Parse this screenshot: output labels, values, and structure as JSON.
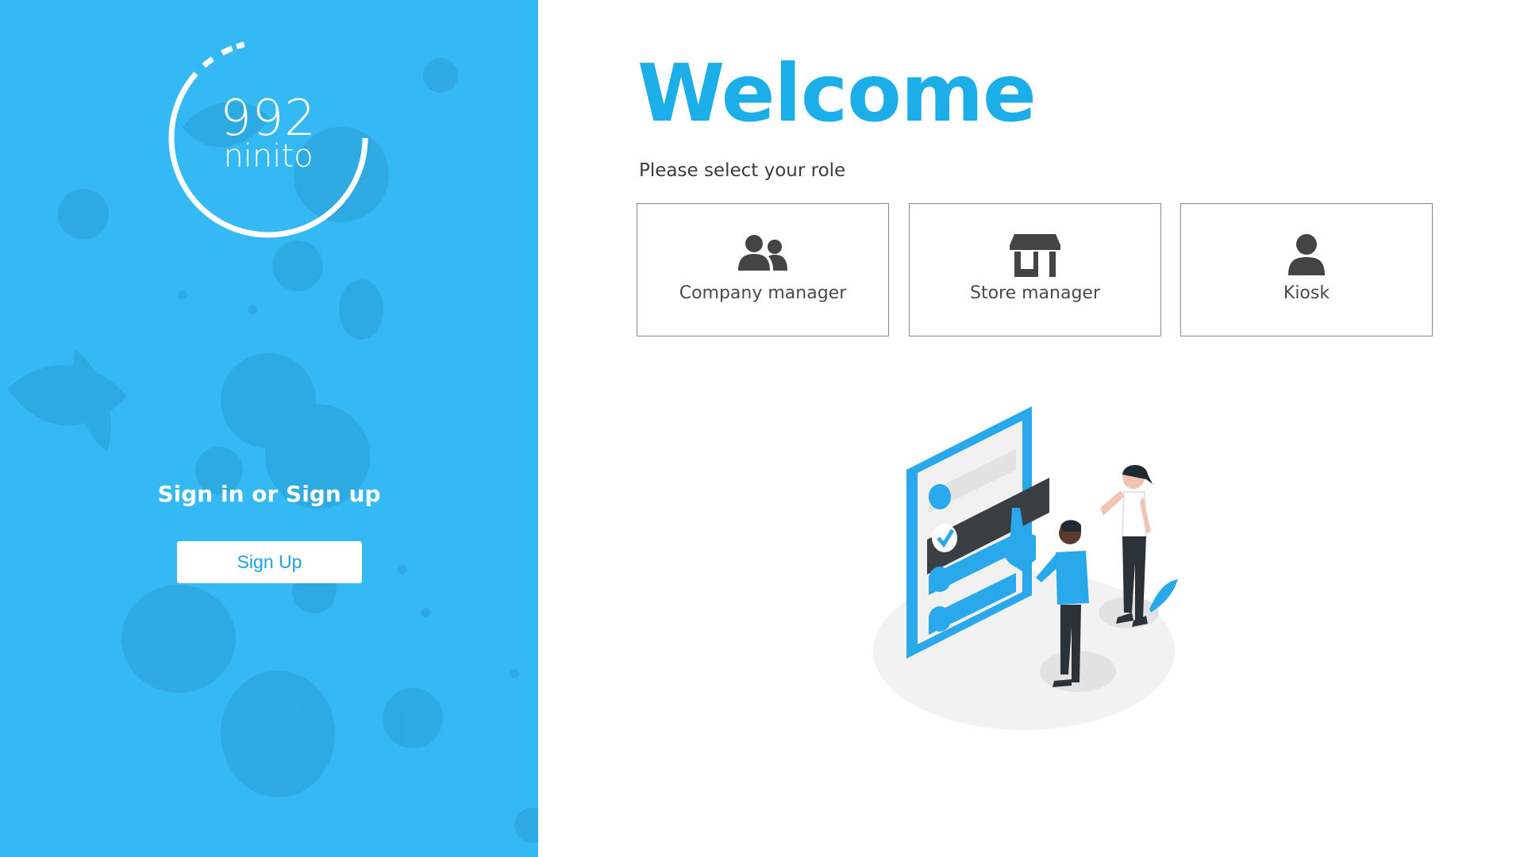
{
  "brand": {
    "logo_number": "992",
    "logo_word": "ninito"
  },
  "auth": {
    "heading": "Sign in or Sign up",
    "signup_label": "Sign Up"
  },
  "main": {
    "title": "Welcome",
    "prompt": "Please select your role",
    "roles": [
      {
        "label": "Company manager",
        "icon": "users-icon"
      },
      {
        "label": "Store manager",
        "icon": "store-icon"
      },
      {
        "label": "Kiosk",
        "icon": "user-icon"
      }
    ]
  },
  "colors": {
    "left_panel": "#35b9f4",
    "accent": "#1baee8",
    "card_border": "#8a8a8a",
    "icon": "#444444"
  }
}
